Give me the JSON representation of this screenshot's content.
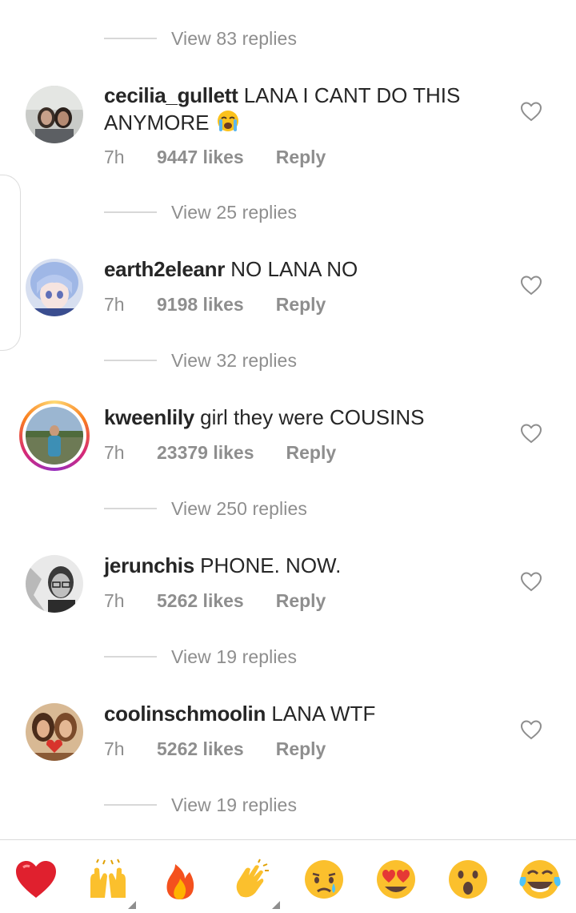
{
  "comments": [
    {
      "username": "cecilia_gullett",
      "text": "LANA I CANT DO THIS ANYMORE",
      "emoji": "loudly-crying-face",
      "time": "7h",
      "likes": "9447 likes",
      "reply": "Reply"
    },
    {
      "username": "earth2eleanr",
      "text": "NO LANA NO",
      "time": "7h",
      "likes": "9198 likes",
      "reply": "Reply"
    },
    {
      "username": "kweenlily",
      "text": "girl they were COUSINS",
      "time": "7h",
      "likes": "23379 likes",
      "reply": "Reply"
    },
    {
      "username": "jerunchis",
      "text": "PHONE. NOW.",
      "time": "7h",
      "likes": "5262 likes",
      "reply": "Reply"
    },
    {
      "username": "coolinschmoolin",
      "text": "LANA WTF",
      "time": "7h",
      "likes": "5262 likes",
      "reply": "Reply"
    }
  ],
  "view_replies": [
    "View 83 replies",
    "View 25 replies",
    "View 32 replies",
    "View 250 replies",
    "View 19 replies",
    "View 19 replies"
  ],
  "reactions": [
    "red-heart",
    "raising-hands",
    "fire",
    "clapping-hands",
    "crying-face",
    "heart-eyes",
    "astonished-face",
    "tears-of-joy"
  ],
  "colors": {
    "text": "#262626",
    "secondary": "#8e8e8e",
    "divider": "#dbdbdb",
    "heart_red": "#ed4956"
  }
}
